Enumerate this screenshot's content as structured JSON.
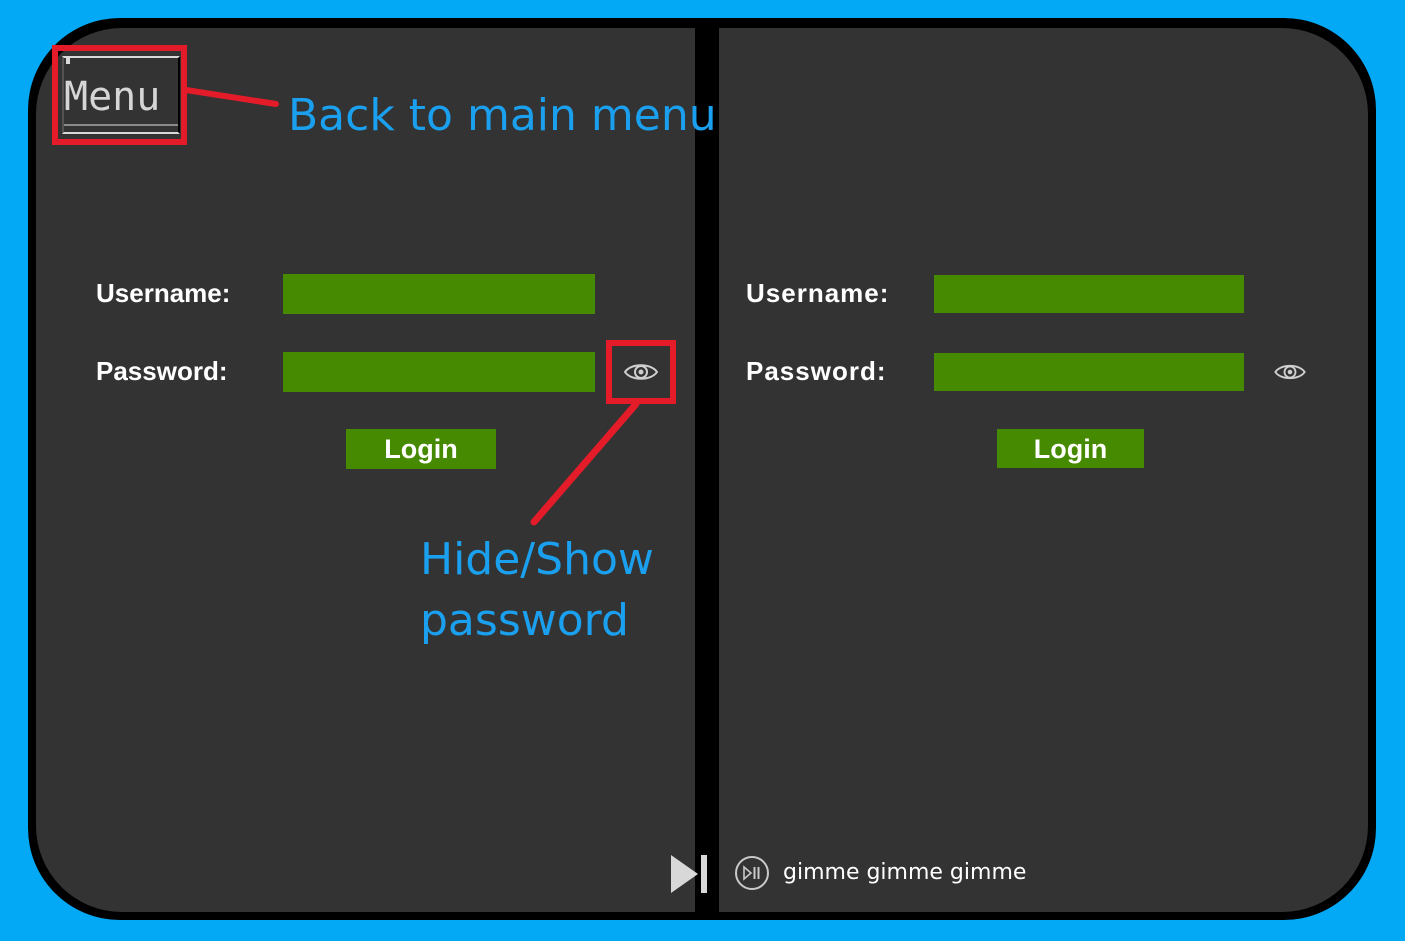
{
  "menu": {
    "label": "Menu"
  },
  "annotations": {
    "menu_note": "Back to main menu",
    "eye_note_line1": "Hide/Show",
    "eye_note_line2": "password",
    "highlight_color": "#e41c2a",
    "note_color": "#1aa0ee"
  },
  "left_form": {
    "username_label": "Username:",
    "password_label": "Password:",
    "username_value": "",
    "password_value": "",
    "login_label": "Login",
    "toggle_icon": "eye-icon"
  },
  "right_form": {
    "username_label": "Username:",
    "password_label": "Password:",
    "username_value": "",
    "password_value": "",
    "login_label": "Login",
    "toggle_icon": "eye-icon"
  },
  "player": {
    "skip_icon": "skip-forward-icon",
    "play_icon": "play-pause-icon",
    "track_title": "gimme gimme gimme"
  },
  "colors": {
    "background": "#03a9f4",
    "panel": "#333333",
    "field": "#458a00",
    "text": "#ffffff"
  }
}
